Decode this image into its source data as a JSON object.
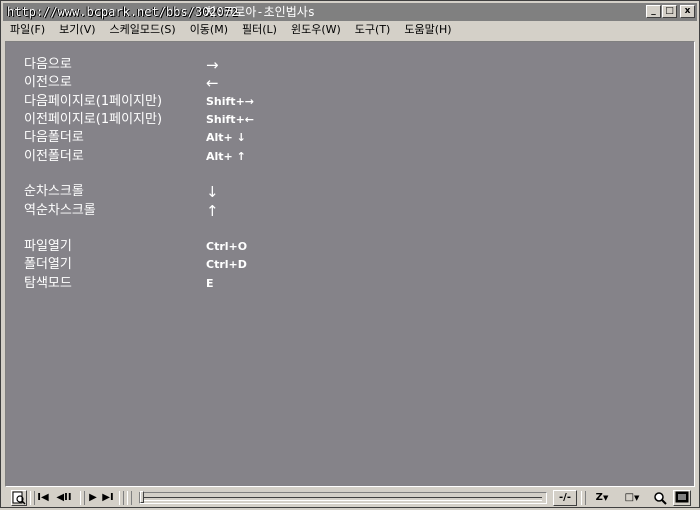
{
  "window": {
    "title_url": "http://www.bcpark.net/bbs/302072",
    "title_rest": "치:크로아-초인법사s",
    "buttons": {
      "minimize": "_",
      "maximize": "□",
      "close": "x"
    }
  },
  "menu": [
    "파일(F)",
    "보기(V)",
    "스케일모드(S)",
    "이동(M)",
    "필터(L)",
    "윈도우(W)",
    "도구(T)",
    "도움말(H)"
  ],
  "shortcuts": [
    {
      "label": "다음으로",
      "key": "→"
    },
    {
      "label": "이전으로",
      "key": "←"
    },
    {
      "label": "다음페이지로(1페이지만)",
      "key": "Shift+→"
    },
    {
      "label": "이전페이지로(1페이지만)",
      "key": "Shift+←"
    },
    {
      "label": "다음폴더로",
      "key": "Alt+ ↓"
    },
    {
      "label": "이전폴더로",
      "key": "Alt+ ↑"
    },
    {
      "label": "순차스크롤",
      "key": "↓"
    },
    {
      "label": "역순차스크롤",
      "key": "↑"
    },
    {
      "label": "파일열기",
      "key": "Ctrl+O"
    },
    {
      "label": "폴더열기",
      "key": "Ctrl+D"
    },
    {
      "label": "탐색모드",
      "key": "E"
    }
  ],
  "toolbar": {
    "first": "I◀",
    "prev": "◀II",
    "next": "▶",
    "last": "▶I",
    "ratio": "-/-",
    "zoom_mode": "Z",
    "page_mode": "□",
    "search": "🔍",
    "screen": "▣"
  }
}
